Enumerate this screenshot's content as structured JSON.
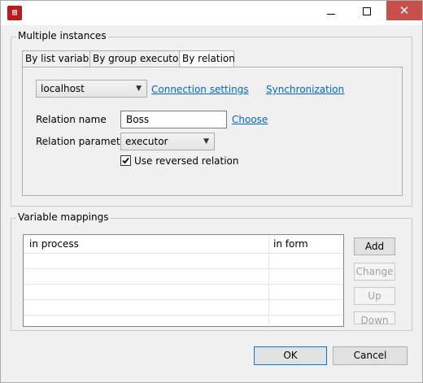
{
  "window": {
    "title": "",
    "icon": "app-logo-icon"
  },
  "caption": {
    "minimize": "minimize-icon",
    "maximize": "maximize-icon",
    "close_glyph": "✕"
  },
  "multiple_instances": {
    "label": "Multiple instances",
    "tabs": [
      {
        "label": "By list variable",
        "active": false
      },
      {
        "label": "By group executors",
        "active": false
      },
      {
        "label": "By relation",
        "active": true
      }
    ],
    "host": {
      "value": "localhost"
    },
    "connection_settings": "Connection settings",
    "synchronization": "Synchronization",
    "relation_name_label": "Relation name",
    "relation_name_value": "Boss",
    "choose": "Choose",
    "relation_parameter_label": "Relation parameter",
    "relation_parameter_value": "executor",
    "use_reversed_label": "Use reversed relation",
    "use_reversed_checked": true
  },
  "variable_mappings": {
    "label": "Variable mappings",
    "columns": [
      "in process",
      "in form"
    ],
    "rows": [],
    "buttons": {
      "add": "Add",
      "change": "Change",
      "up": "Up",
      "down": "Down"
    }
  },
  "footer": {
    "ok": "OK",
    "cancel": "Cancel"
  },
  "colors": {
    "link": "#0066cc",
    "close_button": "#c7514a",
    "default_button_border": "#0078d7"
  }
}
